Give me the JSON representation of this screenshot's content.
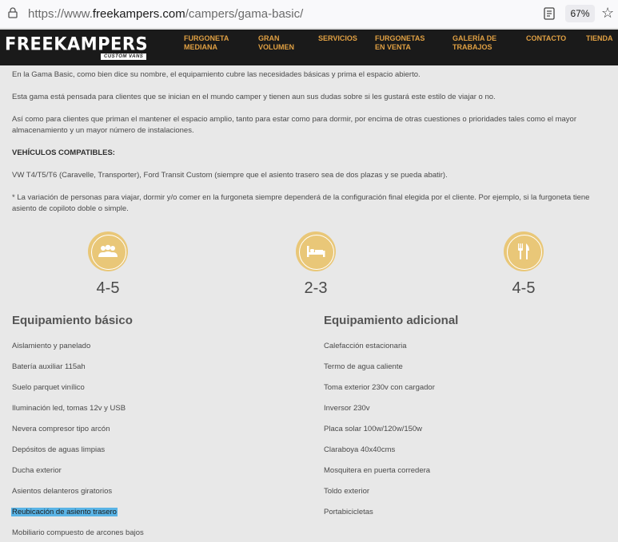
{
  "browser": {
    "url_prefix": "https://www.",
    "url_host": "freekampers.com",
    "url_path": "/campers/gama-basic/",
    "zoom": "67%"
  },
  "header": {
    "logo": "FREEKAMPERS",
    "logo_sub": "CUSTOM VANS",
    "nav": [
      "FURGONETA\nMEDIANA",
      "GRAN\nVOLUMEN",
      "SERVICIOS",
      "FURGONETAS\nEN VENTA",
      "GALERÍA DE\nTRABAJOS",
      "CONTACTO",
      "TIENDA"
    ]
  },
  "content": {
    "p1": "En la Gama Basic, como bien dice su nombre, el equipamiento cubre las necesidades básicas y prima el espacio abierto.",
    "p2": "Esta gama está pensada para clientes que se inician en el mundo camper y tienen aun sus dudas sobre si les gustará este estilo de viajar o no.",
    "p3": "Así como para clientes que priman el mantener el espacio amplio, tanto para estar como para dormir, por encima de otras cuestiones o prioridades tales como el mayor almacenamiento y un mayor número de instalaciones.",
    "compat_title": "VEHÍCULOS COMPATIBLES:",
    "compat_text": "VW T4/T5/T6 (Caravelle, Transporter), Ford Transit Custom (siempre que el asiento trasero sea de dos plazas y se pueda abatir).",
    "note": "* La variación de personas para viajar, dormir y/o comer en la furgoneta siempre dependerá de la configuración final elegida por el cliente. Por ejemplo, si la furgoneta tiene asiento de copiloto doble o simple."
  },
  "capacities": [
    {
      "icon": "people-icon",
      "value": "4-5"
    },
    {
      "icon": "bed-icon",
      "value": "2-3"
    },
    {
      "icon": "cutlery-icon",
      "value": "4-5"
    }
  ],
  "basic": {
    "title": "Equipamiento básico",
    "items": [
      "Aislamiento y panelado",
      "Batería auxiliar 115ah",
      "Suelo parquet vinílico",
      "Iluminación led, tomas 12v y USB",
      "Nevera compresor tipo arcón",
      "Depósitos de aguas limpias",
      "Ducha exterior",
      "Asientos delanteros giratorios",
      "Reubicación de asiento trasero",
      "Mobiliario compuesto de arcones bajos"
    ]
  },
  "additional": {
    "title": "Equipamiento adicional",
    "items": [
      "Calefacción estacionaria",
      "Termo de agua caliente",
      "Toma exterior 230v con cargador",
      "Inversor 230v",
      "Placa solar 100w/120w/150w",
      "Claraboya 40x40cms",
      "Mosquitera en puerta corredera",
      "Toldo exterior",
      "Portabicicletas"
    ]
  },
  "colors": {
    "accent": "#e0a043",
    "icon_bg": "#e9c778",
    "header_bg": "#1a1a1a",
    "page_bg": "#e8e8e8",
    "selection": "#5ab4e6"
  }
}
